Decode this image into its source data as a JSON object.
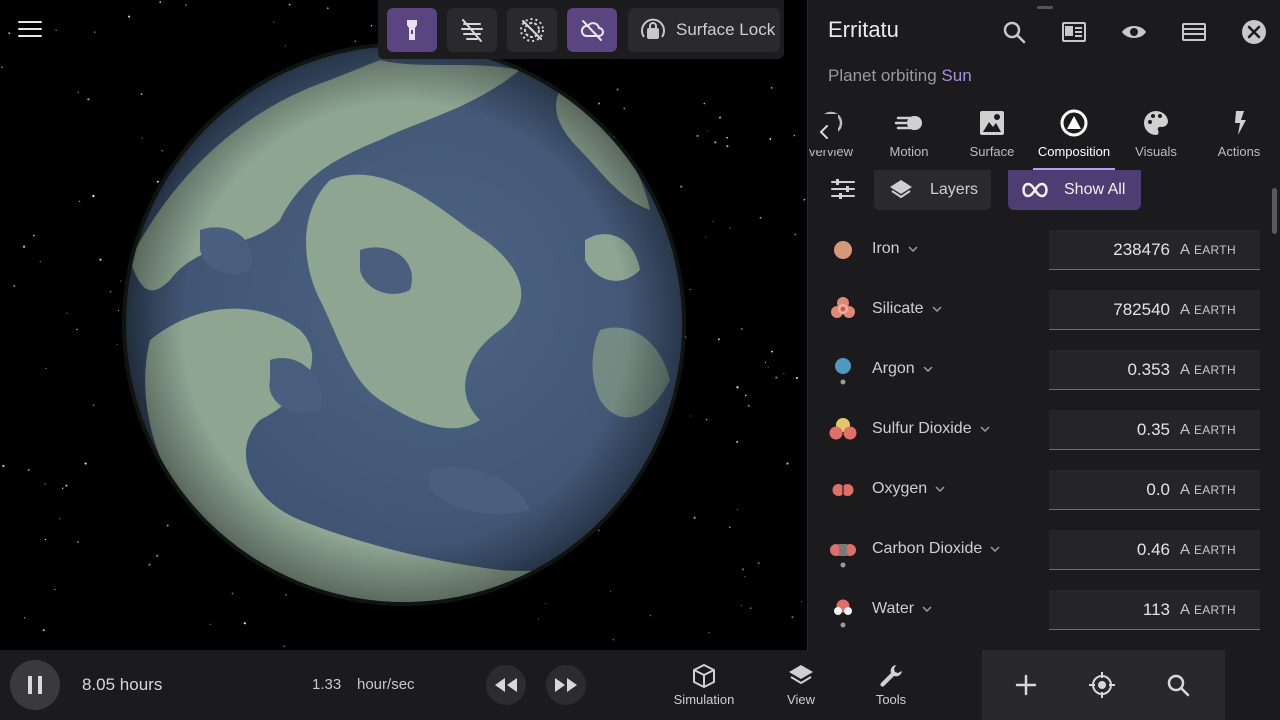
{
  "viewport": {
    "toolbar": {
      "buttons": [
        {
          "icon": "flashlight-icon",
          "active": true
        },
        {
          "icon": "no-orbit-lines-icon",
          "active": false
        },
        {
          "icon": "hide-labels-icon",
          "active": false
        },
        {
          "icon": "hide-clouds-icon",
          "active": true
        }
      ],
      "surface_lock_label": "Surface Lock"
    }
  },
  "panel": {
    "title": "Erritatu",
    "subtitle_prefix": "Planet orbiting",
    "subtitle_link": "Sun",
    "header_icons": [
      "search-icon",
      "article-icon",
      "eye-icon",
      "list-icon",
      "close-icon"
    ],
    "tabs": [
      {
        "label": "Overview",
        "visible_label": "verview",
        "icon": "overview-icon",
        "active": false
      },
      {
        "label": "Motion",
        "icon": "motion-icon",
        "active": false
      },
      {
        "label": "Surface",
        "icon": "surface-icon",
        "active": false
      },
      {
        "label": "Composition",
        "icon": "composition-icon",
        "active": true
      },
      {
        "label": "Visuals",
        "icon": "palette-icon",
        "active": false
      },
      {
        "label": "Actions",
        "icon": "lightning-icon",
        "active": false
      }
    ],
    "filters": {
      "layers_label": "Layers",
      "show_all_label": "Show All"
    },
    "composition": [
      {
        "name": "Iron",
        "value": "238476",
        "unit_symbol": "A",
        "unit": "EARTH"
      },
      {
        "name": "Silicate",
        "value": "782540",
        "unit_symbol": "A",
        "unit": "EARTH"
      },
      {
        "name": "Argon",
        "value": "0.353",
        "unit_symbol": "A",
        "unit": "EARTH"
      },
      {
        "name": "Sulfur Dioxide",
        "value": "0.35",
        "unit_symbol": "A",
        "unit": "EARTH"
      },
      {
        "name": "Oxygen",
        "value": "0.0",
        "unit_symbol": "A",
        "unit": "EARTH"
      },
      {
        "name": "Carbon Dioxide",
        "value": "0.46",
        "unit_symbol": "A",
        "unit": "EARTH"
      },
      {
        "name": "Water",
        "value": "113",
        "unit_symbol": "A",
        "unit": "EARTH"
      }
    ]
  },
  "bottombar": {
    "elapsed": "8.05 hours",
    "rate_value": "1.33",
    "rate_unit": "hour/sec",
    "nav": [
      {
        "label": "Simulation",
        "icon": "cube-icon"
      },
      {
        "label": "View",
        "icon": "layers-icon"
      },
      {
        "label": "Tools",
        "icon": "wrench-icon"
      }
    ],
    "right_icons": [
      "add-icon",
      "focus-target-icon",
      "search-icon"
    ]
  },
  "colors": {
    "accent": "#5a4580",
    "accent_light": "#b79cf0",
    "link": "#a88ee0",
    "panel_bg": "#1b1b1d"
  }
}
